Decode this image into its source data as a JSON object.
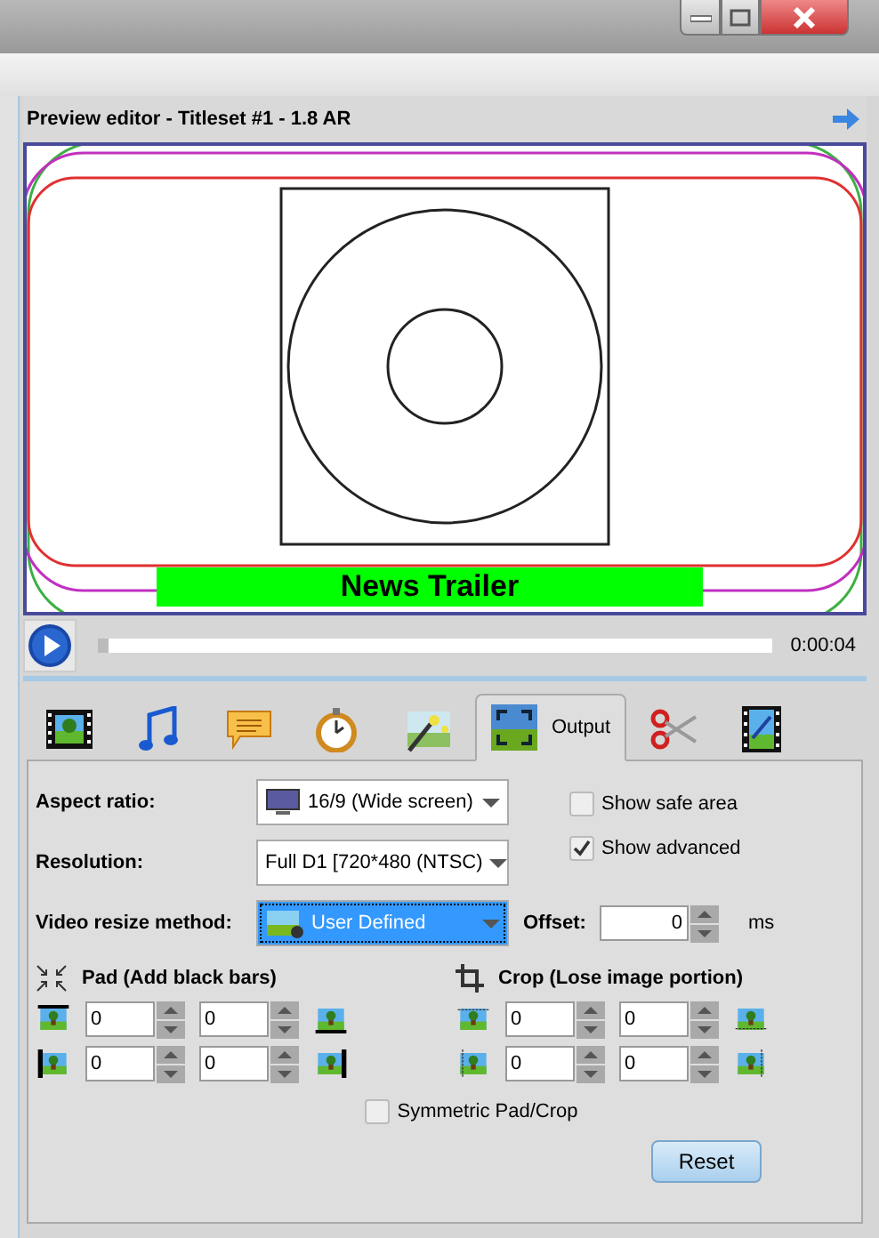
{
  "preview": {
    "title": "Preview editor - Titleset #1 - 1.8 AR",
    "caption": "News Trailer",
    "playback": {
      "level": 0,
      "time": "0:00:04"
    }
  },
  "tabs": [
    {
      "selected": false
    },
    {
      "selected": false
    },
    {
      "selected": false
    },
    {
      "selected": false
    },
    {
      "selected": false
    },
    {
      "label": "Output",
      "selected": true
    },
    {
      "selected": false
    },
    {
      "selected": false
    }
  ],
  "output": {
    "aspect_ratio": {
      "label": "Aspect ratio:",
      "value": "16/9 (Wide screen)"
    },
    "resolution": {
      "label": "Resolution:",
      "value": "Full D1 [720*480 (NTSC)"
    },
    "resize_method": {
      "label": "Video resize method:",
      "value": "User Defined",
      "focused": true
    },
    "offset": {
      "label": "Offset:",
      "value": "0",
      "unit": "ms"
    },
    "options": [
      {
        "label": "Show safe area",
        "checked": false
      },
      {
        "label": "Show advanced",
        "checked": true
      }
    ],
    "pad": {
      "title": "Pad (Add black bars)",
      "fields": [
        "0",
        "0",
        "0",
        "0"
      ]
    },
    "crop": {
      "title": "Crop (Lose image portion)",
      "fields": [
        "0",
        "0",
        "0",
        "0"
      ]
    },
    "symmetric": {
      "label": "Symmetric Pad/Crop",
      "checked": false
    },
    "reset": "Reset"
  }
}
